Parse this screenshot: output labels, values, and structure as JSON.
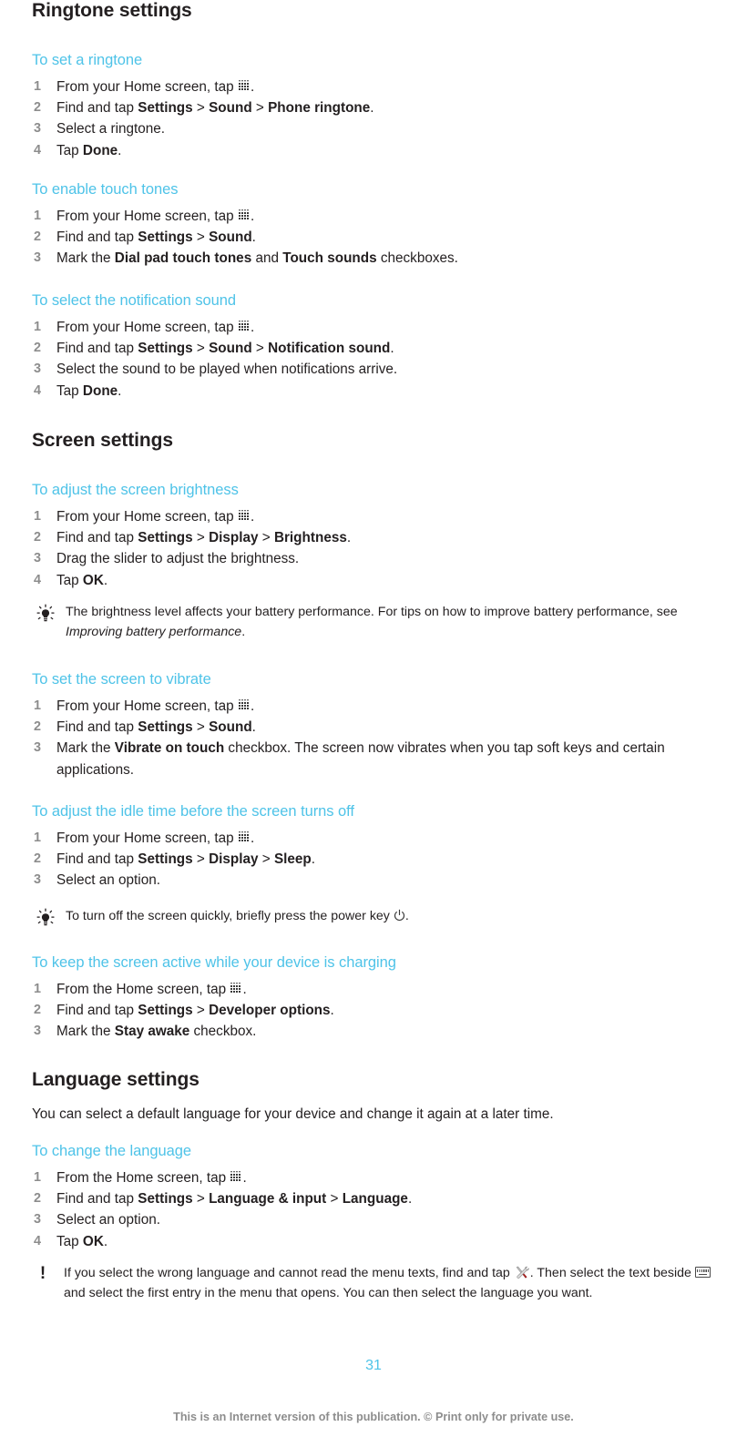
{
  "document": {
    "page_number": "31",
    "footer_note": "This is an Internet version of this publication. © Print only for private use.",
    "accent_color": "#4ec3e8",
    "text_color": "#231f20",
    "muted_color": "#8d8d8d"
  },
  "sections": [
    {
      "title": "Ringtone settings",
      "tasks": [
        {
          "title": "To set a ringtone",
          "steps": [
            {
              "parts": [
                {
                  "t": "text",
                  "v": "From your Home screen, tap "
                },
                {
                  "t": "icon",
                  "v": "app-drawer-icon"
                },
                {
                  "t": "text",
                  "v": "."
                }
              ]
            },
            {
              "parts": [
                {
                  "t": "text",
                  "v": "Find and tap "
                },
                {
                  "t": "bold",
                  "v": "Settings"
                },
                {
                  "t": "text",
                  "v": " > "
                },
                {
                  "t": "bold",
                  "v": "Sound"
                },
                {
                  "t": "text",
                  "v": " > "
                },
                {
                  "t": "bold",
                  "v": "Phone ringtone"
                },
                {
                  "t": "text",
                  "v": "."
                }
              ]
            },
            {
              "parts": [
                {
                  "t": "text",
                  "v": "Select a ringtone."
                }
              ]
            },
            {
              "parts": [
                {
                  "t": "text",
                  "v": "Tap "
                },
                {
                  "t": "bold",
                  "v": "Done"
                },
                {
                  "t": "text",
                  "v": "."
                }
              ]
            }
          ]
        },
        {
          "title": "To enable touch tones",
          "steps": [
            {
              "parts": [
                {
                  "t": "text",
                  "v": "From your Home screen, tap "
                },
                {
                  "t": "icon",
                  "v": "app-drawer-icon"
                },
                {
                  "t": "text",
                  "v": "."
                }
              ]
            },
            {
              "parts": [
                {
                  "t": "text",
                  "v": "Find and tap "
                },
                {
                  "t": "bold",
                  "v": "Settings"
                },
                {
                  "t": "text",
                  "v": " > "
                },
                {
                  "t": "bold",
                  "v": "Sound"
                },
                {
                  "t": "text",
                  "v": "."
                }
              ]
            },
            {
              "parts": [
                {
                  "t": "text",
                  "v": "Mark the "
                },
                {
                  "t": "bold",
                  "v": "Dial pad touch tones"
                },
                {
                  "t": "text",
                  "v": " and "
                },
                {
                  "t": "bold",
                  "v": "Touch sounds"
                },
                {
                  "t": "text",
                  "v": " checkboxes."
                }
              ]
            }
          ]
        },
        {
          "title": "To select the notification sound",
          "steps": [
            {
              "parts": [
                {
                  "t": "text",
                  "v": "From your Home screen, tap "
                },
                {
                  "t": "icon",
                  "v": "app-drawer-icon"
                },
                {
                  "t": "text",
                  "v": "."
                }
              ]
            },
            {
              "parts": [
                {
                  "t": "text",
                  "v": "Find and tap "
                },
                {
                  "t": "bold",
                  "v": "Settings"
                },
                {
                  "t": "text",
                  "v": " > "
                },
                {
                  "t": "bold",
                  "v": "Sound"
                },
                {
                  "t": "text",
                  "v": " > "
                },
                {
                  "t": "bold",
                  "v": "Notification sound"
                },
                {
                  "t": "text",
                  "v": "."
                }
              ]
            },
            {
              "parts": [
                {
                  "t": "text",
                  "v": "Select the sound to be played when notifications arrive."
                }
              ]
            },
            {
              "parts": [
                {
                  "t": "text",
                  "v": "Tap "
                },
                {
                  "t": "bold",
                  "v": "Done"
                },
                {
                  "t": "text",
                  "v": "."
                }
              ]
            }
          ]
        }
      ]
    },
    {
      "title": "Screen settings",
      "tasks": [
        {
          "title": "To adjust the screen brightness",
          "steps": [
            {
              "parts": [
                {
                  "t": "text",
                  "v": "From your Home screen, tap "
                },
                {
                  "t": "icon",
                  "v": "app-drawer-icon"
                },
                {
                  "t": "text",
                  "v": "."
                }
              ]
            },
            {
              "parts": [
                {
                  "t": "text",
                  "v": "Find and tap "
                },
                {
                  "t": "bold",
                  "v": "Settings"
                },
                {
                  "t": "text",
                  "v": " > "
                },
                {
                  "t": "bold",
                  "v": "Display"
                },
                {
                  "t": "text",
                  "v": " > "
                },
                {
                  "t": "bold",
                  "v": "Brightness"
                },
                {
                  "t": "text",
                  "v": "."
                }
              ]
            },
            {
              "parts": [
                {
                  "t": "text",
                  "v": "Drag the slider to adjust the brightness."
                }
              ]
            },
            {
              "parts": [
                {
                  "t": "text",
                  "v": "Tap "
                },
                {
                  "t": "bold",
                  "v": "OK"
                },
                {
                  "t": "text",
                  "v": "."
                }
              ]
            }
          ]
        },
        {
          "title": "To set the screen to vibrate",
          "steps": [
            {
              "parts": [
                {
                  "t": "text",
                  "v": "From your Home screen, tap "
                },
                {
                  "t": "icon",
                  "v": "app-drawer-icon"
                },
                {
                  "t": "text",
                  "v": "."
                }
              ]
            },
            {
              "parts": [
                {
                  "t": "text",
                  "v": "Find and tap "
                },
                {
                  "t": "bold",
                  "v": "Settings"
                },
                {
                  "t": "text",
                  "v": " > "
                },
                {
                  "t": "bold",
                  "v": "Sound"
                },
                {
                  "t": "text",
                  "v": "."
                }
              ]
            },
            {
              "parts": [
                {
                  "t": "text",
                  "v": "Mark the "
                },
                {
                  "t": "bold",
                  "v": "Vibrate on touch"
                },
                {
                  "t": "text",
                  "v": " checkbox. The screen now vibrates when you tap soft keys and certain applications."
                }
              ]
            }
          ]
        },
        {
          "title": "To adjust the idle time before the screen turns off",
          "steps": [
            {
              "parts": [
                {
                  "t": "text",
                  "v": "From your Home screen, tap "
                },
                {
                  "t": "icon",
                  "v": "app-drawer-icon"
                },
                {
                  "t": "text",
                  "v": "."
                }
              ]
            },
            {
              "parts": [
                {
                  "t": "text",
                  "v": "Find and tap "
                },
                {
                  "t": "bold",
                  "v": "Settings"
                },
                {
                  "t": "text",
                  "v": " > "
                },
                {
                  "t": "bold",
                  "v": "Display"
                },
                {
                  "t": "text",
                  "v": " > "
                },
                {
                  "t": "bold",
                  "v": "Sleep"
                },
                {
                  "t": "text",
                  "v": "."
                }
              ]
            },
            {
              "parts": [
                {
                  "t": "text",
                  "v": "Select an option."
                }
              ]
            }
          ]
        },
        {
          "title": "To keep the screen active while your device is charging",
          "steps": [
            {
              "parts": [
                {
                  "t": "text",
                  "v": "From the Home screen, tap "
                },
                {
                  "t": "icon",
                  "v": "app-drawer-icon"
                },
                {
                  "t": "text",
                  "v": "."
                }
              ]
            },
            {
              "parts": [
                {
                  "t": "text",
                  "v": "Find and tap "
                },
                {
                  "t": "bold",
                  "v": "Settings"
                },
                {
                  "t": "text",
                  "v": " > "
                },
                {
                  "t": "bold",
                  "v": "Developer options"
                },
                {
                  "t": "text",
                  "v": "."
                }
              ]
            },
            {
              "parts": [
                {
                  "t": "text",
                  "v": "Mark the "
                },
                {
                  "t": "bold",
                  "v": "Stay awake"
                },
                {
                  "t": "text",
                  "v": " checkbox."
                }
              ]
            }
          ]
        }
      ]
    },
    {
      "title": "Language settings",
      "intro": "You can select a default language for your device and change it again at a later time.",
      "tasks": [
        {
          "title": "To change the language",
          "steps": [
            {
              "parts": [
                {
                  "t": "text",
                  "v": "From the Home screen, tap "
                },
                {
                  "t": "icon",
                  "v": "app-drawer-icon"
                },
                {
                  "t": "text",
                  "v": "."
                }
              ]
            },
            {
              "parts": [
                {
                  "t": "text",
                  "v": "Find and tap "
                },
                {
                  "t": "bold",
                  "v": "Settings"
                },
                {
                  "t": "text",
                  "v": " > "
                },
                {
                  "t": "bold",
                  "v": "Language & input"
                },
                {
                  "t": "text",
                  "v": " > "
                },
                {
                  "t": "bold",
                  "v": "Language"
                },
                {
                  "t": "text",
                  "v": "."
                }
              ]
            },
            {
              "parts": [
                {
                  "t": "text",
                  "v": "Select an option."
                }
              ]
            },
            {
              "parts": [
                {
                  "t": "text",
                  "v": "Tap "
                },
                {
                  "t": "bold",
                  "v": "OK"
                },
                {
                  "t": "text",
                  "v": "."
                }
              ]
            }
          ]
        }
      ]
    }
  ],
  "notes": {
    "brightness_tip": {
      "icon": "lightbulb-tip-icon",
      "parts": [
        {
          "t": "text",
          "v": "The brightness level affects your battery performance. For tips on how to improve battery performance, see "
        },
        {
          "t": "italic",
          "v": "Improving battery performance"
        },
        {
          "t": "text",
          "v": "."
        }
      ]
    },
    "power_key_tip": {
      "icon": "lightbulb-tip-icon",
      "parts": [
        {
          "t": "text",
          "v": "To turn off the screen quickly, briefly press the power key "
        },
        {
          "t": "icon",
          "v": "power-key-icon"
        },
        {
          "t": "text",
          "v": "."
        }
      ]
    },
    "language_warning": {
      "icon": "exclamation-warning-icon",
      "parts": [
        {
          "t": "text",
          "v": "If you select the wrong language and cannot read the menu texts, find and tap "
        },
        {
          "t": "icon",
          "v": "tools-icon"
        },
        {
          "t": "text",
          "v": ". Then select the text beside "
        },
        {
          "t": "icon",
          "v": "keyboard-icon"
        },
        {
          "t": "text",
          "v": " and select the first entry in the menu that opens. You can then select the language you want."
        }
      ]
    }
  }
}
